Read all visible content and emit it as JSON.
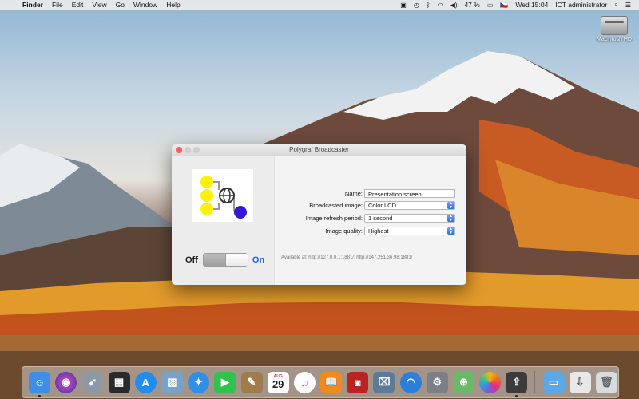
{
  "menubar": {
    "apple_glyph": "",
    "app_name": "Finder",
    "menus": [
      "File",
      "Edit",
      "View",
      "Go",
      "Window",
      "Help"
    ],
    "battery": "47 %",
    "keyboard_flag": "🇨🇿",
    "clock": "Wed 15:04",
    "user": "ICT administrator",
    "status_icons": [
      "dropbox-icon",
      "time-machine-icon",
      "bluetooth-icon",
      "wifi-icon",
      "volume-icon",
      "battery-icon",
      "keyboard-layout-icon",
      "search-icon",
      "list-icon"
    ]
  },
  "desktop": {
    "disk_label": "Macintosh HD"
  },
  "window": {
    "title": "Polygraf Broadcaster",
    "toggle": {
      "off_label": "Off",
      "on_label": "On",
      "state": "on"
    },
    "form": {
      "name_label": "Name:",
      "name_value": "Presentation screen",
      "image_label": "Broadcasted image:",
      "image_value": "Color LCD",
      "refresh_label": "Image refresh period:",
      "refresh_value": "1 second",
      "quality_label": "Image quality:",
      "quality_value": "Highest"
    },
    "available_text": "Available at: http://127.0.0.1:1881/; http://147.251.36.98:1881/"
  },
  "dock": {
    "calendar_month": "AUG",
    "calendar_day": "29",
    "items": [
      {
        "name": "finder",
        "color": "#3d8fe6"
      },
      {
        "name": "siri",
        "color": "#5a3fd0"
      },
      {
        "name": "launchpad",
        "color": "#8b98a8"
      },
      {
        "name": "mission-control",
        "color": "#2a2a2a"
      },
      {
        "name": "app-store",
        "color": "#1f8cf0"
      },
      {
        "name": "preview",
        "color": "#7aa1c8"
      },
      {
        "name": "safari",
        "color": "#2f8ee8"
      },
      {
        "name": "facetime",
        "color": "#2fc24d"
      },
      {
        "name": "notes",
        "color": "#a07c4c"
      },
      {
        "name": "calendar",
        "color": "#ffffff"
      },
      {
        "name": "itunes",
        "color": "#ee4b7a"
      },
      {
        "name": "ibooks",
        "color": "#f28a1b"
      },
      {
        "name": "photo-booth",
        "color": "#b82424"
      },
      {
        "name": "image-capture",
        "color": "#5e7a9a"
      },
      {
        "name": "network-utility",
        "color": "#2c7fd9"
      },
      {
        "name": "system-preferences",
        "color": "#7b7f86"
      },
      {
        "name": "maps",
        "color": "#6bb86a"
      },
      {
        "name": "photos",
        "color": "#ffffff"
      },
      {
        "name": "polygraf-broadcaster",
        "color": "#3b3b3b"
      },
      {
        "name": "folder",
        "color": "#5aa8e6"
      },
      {
        "name": "downloads",
        "color": "#e8e8e8"
      },
      {
        "name": "trash",
        "color": "#d8dcdf"
      }
    ]
  }
}
